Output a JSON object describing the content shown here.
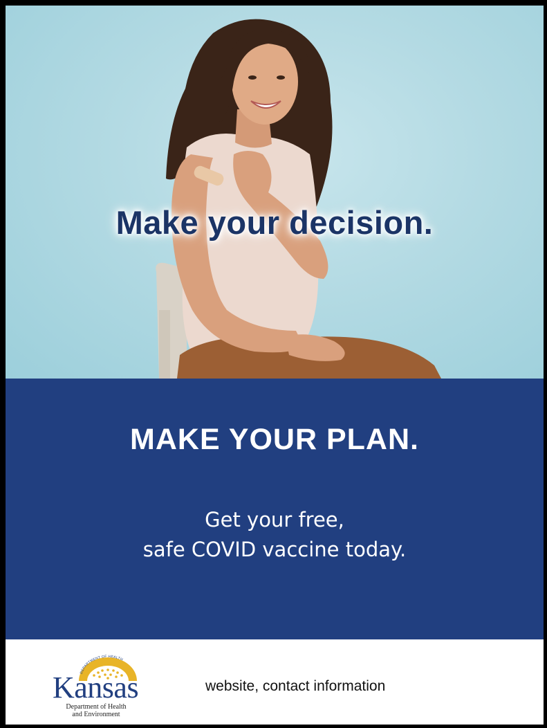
{
  "photo": {
    "headline": "Make your decision."
  },
  "band": {
    "headline": "MAKE YOUR PLAN.",
    "subline_1": "Get your free,",
    "subline_2": "safe COVID vaccine today."
  },
  "footer": {
    "logo": {
      "arc_text": "DEPARTMENT OF HEALTH",
      "wordmark": "Kansas",
      "line_1": "Department of Health",
      "line_2": "and Environment"
    },
    "contact": "website, contact information"
  },
  "colors": {
    "navy": "#213f80",
    "headline_navy": "#1b3466",
    "sky": "#b3dae3",
    "logo_gold": "#e8b428"
  }
}
